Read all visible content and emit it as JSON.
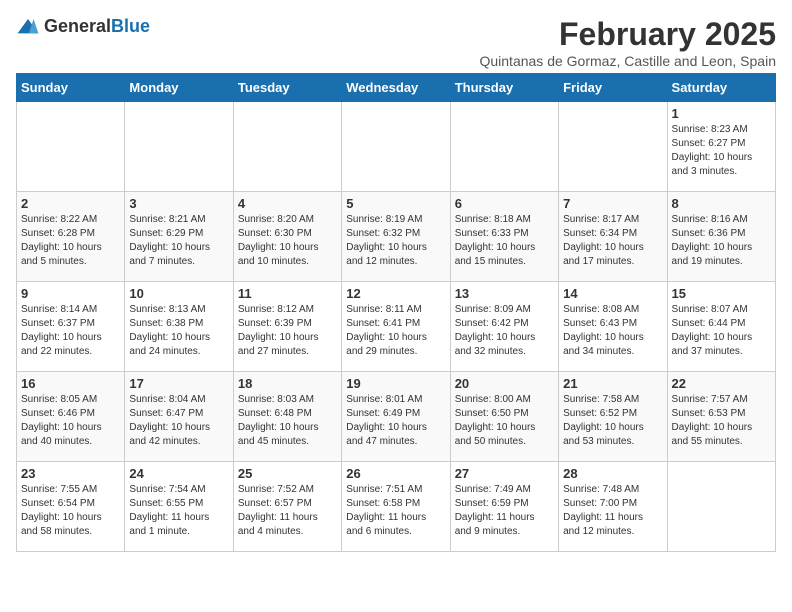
{
  "header": {
    "logo_general": "General",
    "logo_blue": "Blue",
    "month_title": "February 2025",
    "location": "Quintanas de Gormaz, Castille and Leon, Spain"
  },
  "weekdays": [
    "Sunday",
    "Monday",
    "Tuesday",
    "Wednesday",
    "Thursday",
    "Friday",
    "Saturday"
  ],
  "weeks": [
    [
      {
        "day": "",
        "info": ""
      },
      {
        "day": "",
        "info": ""
      },
      {
        "day": "",
        "info": ""
      },
      {
        "day": "",
        "info": ""
      },
      {
        "day": "",
        "info": ""
      },
      {
        "day": "",
        "info": ""
      },
      {
        "day": "1",
        "info": "Sunrise: 8:23 AM\nSunset: 6:27 PM\nDaylight: 10 hours\nand 3 minutes."
      }
    ],
    [
      {
        "day": "2",
        "info": "Sunrise: 8:22 AM\nSunset: 6:28 PM\nDaylight: 10 hours\nand 5 minutes."
      },
      {
        "day": "3",
        "info": "Sunrise: 8:21 AM\nSunset: 6:29 PM\nDaylight: 10 hours\nand 7 minutes."
      },
      {
        "day": "4",
        "info": "Sunrise: 8:20 AM\nSunset: 6:30 PM\nDaylight: 10 hours\nand 10 minutes."
      },
      {
        "day": "5",
        "info": "Sunrise: 8:19 AM\nSunset: 6:32 PM\nDaylight: 10 hours\nand 12 minutes."
      },
      {
        "day": "6",
        "info": "Sunrise: 8:18 AM\nSunset: 6:33 PM\nDaylight: 10 hours\nand 15 minutes."
      },
      {
        "day": "7",
        "info": "Sunrise: 8:17 AM\nSunset: 6:34 PM\nDaylight: 10 hours\nand 17 minutes."
      },
      {
        "day": "8",
        "info": "Sunrise: 8:16 AM\nSunset: 6:36 PM\nDaylight: 10 hours\nand 19 minutes."
      }
    ],
    [
      {
        "day": "9",
        "info": "Sunrise: 8:14 AM\nSunset: 6:37 PM\nDaylight: 10 hours\nand 22 minutes."
      },
      {
        "day": "10",
        "info": "Sunrise: 8:13 AM\nSunset: 6:38 PM\nDaylight: 10 hours\nand 24 minutes."
      },
      {
        "day": "11",
        "info": "Sunrise: 8:12 AM\nSunset: 6:39 PM\nDaylight: 10 hours\nand 27 minutes."
      },
      {
        "day": "12",
        "info": "Sunrise: 8:11 AM\nSunset: 6:41 PM\nDaylight: 10 hours\nand 29 minutes."
      },
      {
        "day": "13",
        "info": "Sunrise: 8:09 AM\nSunset: 6:42 PM\nDaylight: 10 hours\nand 32 minutes."
      },
      {
        "day": "14",
        "info": "Sunrise: 8:08 AM\nSunset: 6:43 PM\nDaylight: 10 hours\nand 34 minutes."
      },
      {
        "day": "15",
        "info": "Sunrise: 8:07 AM\nSunset: 6:44 PM\nDaylight: 10 hours\nand 37 minutes."
      }
    ],
    [
      {
        "day": "16",
        "info": "Sunrise: 8:05 AM\nSunset: 6:46 PM\nDaylight: 10 hours\nand 40 minutes."
      },
      {
        "day": "17",
        "info": "Sunrise: 8:04 AM\nSunset: 6:47 PM\nDaylight: 10 hours\nand 42 minutes."
      },
      {
        "day": "18",
        "info": "Sunrise: 8:03 AM\nSunset: 6:48 PM\nDaylight: 10 hours\nand 45 minutes."
      },
      {
        "day": "19",
        "info": "Sunrise: 8:01 AM\nSunset: 6:49 PM\nDaylight: 10 hours\nand 47 minutes."
      },
      {
        "day": "20",
        "info": "Sunrise: 8:00 AM\nSunset: 6:50 PM\nDaylight: 10 hours\nand 50 minutes."
      },
      {
        "day": "21",
        "info": "Sunrise: 7:58 AM\nSunset: 6:52 PM\nDaylight: 10 hours\nand 53 minutes."
      },
      {
        "day": "22",
        "info": "Sunrise: 7:57 AM\nSunset: 6:53 PM\nDaylight: 10 hours\nand 55 minutes."
      }
    ],
    [
      {
        "day": "23",
        "info": "Sunrise: 7:55 AM\nSunset: 6:54 PM\nDaylight: 10 hours\nand 58 minutes."
      },
      {
        "day": "24",
        "info": "Sunrise: 7:54 AM\nSunset: 6:55 PM\nDaylight: 11 hours\nand 1 minute."
      },
      {
        "day": "25",
        "info": "Sunrise: 7:52 AM\nSunset: 6:57 PM\nDaylight: 11 hours\nand 4 minutes."
      },
      {
        "day": "26",
        "info": "Sunrise: 7:51 AM\nSunset: 6:58 PM\nDaylight: 11 hours\nand 6 minutes."
      },
      {
        "day": "27",
        "info": "Sunrise: 7:49 AM\nSunset: 6:59 PM\nDaylight: 11 hours\nand 9 minutes."
      },
      {
        "day": "28",
        "info": "Sunrise: 7:48 AM\nSunset: 7:00 PM\nDaylight: 11 hours\nand 12 minutes."
      },
      {
        "day": "",
        "info": ""
      }
    ]
  ]
}
